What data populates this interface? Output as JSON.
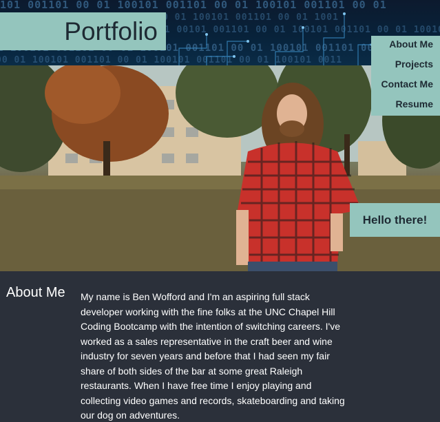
{
  "header": {
    "title": "Portfolio",
    "binary_rows": [
      "101 001101 00 01 100101 001101 00 01 100101 001101 00 01",
      "1 001 1001 0 0001101 001101 00 01 100101 001101 00 01 1001",
      "01 00101 001101 00 01 100101 001101 00 01 100101 001101 00",
      "1 100101 001101 00 01 100101 001101 00 01 100101 001101 00",
      "00 01 100101 001101 00 01 100101 001101 00 01 100101 0011"
    ]
  },
  "nav": {
    "items": [
      {
        "label": "About Me"
      },
      {
        "label": "Projects"
      },
      {
        "label": "Contact Me"
      },
      {
        "label": "Resume"
      }
    ]
  },
  "hero": {
    "greeting": "Hello there!"
  },
  "about": {
    "heading": "About Me",
    "body": "My name is Ben Wofford and I'm an aspiring full stack developer working with the fine folks at the UNC Chapel Hill Coding Bootcamp with the intention of switching careers. I've worked as a sales representative in the craft beer and wine industry for seven years and before that I had seen my fair share of both sides of the bar at some great Raleigh restaurants. When I have free time I enjoy playing and collecting video games and records, skateboarding and taking our dog on adventures."
  },
  "colors": {
    "accent": "#94c5bd",
    "background": "#2b303a",
    "header_bg": "#0c1a2e"
  }
}
